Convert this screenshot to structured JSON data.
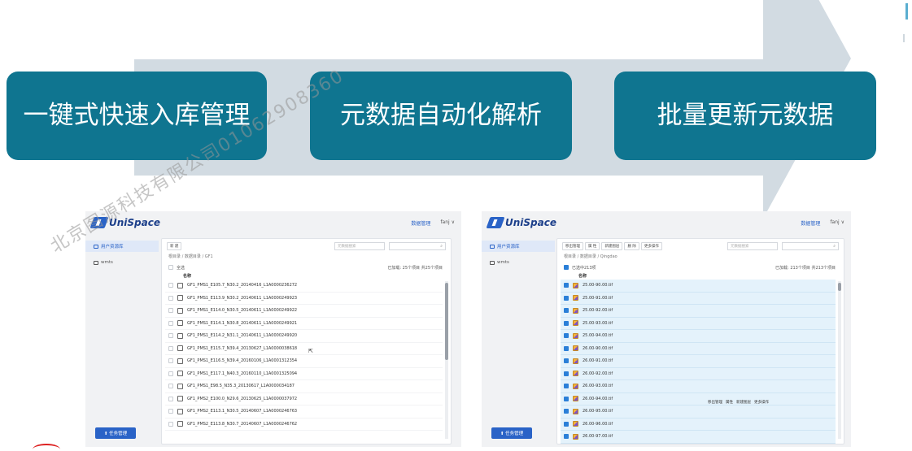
{
  "banner": {
    "steps": [
      "一键式快速入库管理",
      "元数据自动化解析",
      "批量更新元数据"
    ],
    "watermark": "北京图源科技有限公司01062908360"
  },
  "app1": {
    "logo": "UniSpace",
    "nav": {
      "data_mgmt": "数据管理",
      "user": "fanj ∨"
    },
    "sidebar": [
      "用户资源库",
      "wmts"
    ],
    "task_button": "⬆ 任务管理",
    "toolbar": [
      "新 建"
    ],
    "search_select_placeholder": "元数据搜索",
    "breadcrumb": "根目录 / 数据目录 / GF1",
    "select_all": "全选",
    "count": "已加载: 25个项目  共25个项目",
    "column_name": "名称",
    "files": [
      "GF1_PMS1_E105.7_N30.2_20140416_L1A0000236272",
      "GF1_PMS1_E113.9_N30.2_20140611_L1A0000249923",
      "GF1_PMS1_E114.0_N30.5_20140611_L1A0000249922",
      "GF1_PMS1_E114.1_N30.8_20140611_L1A0000249921",
      "GF1_PMS1_E114.2_N31.1_20140611_L1A0000249920",
      "GF1_PMS1_E115.7_N39.4_20130627_L1A0000038618",
      "GF1_PMS1_E116.5_N39.4_20160106_L1A0001312354",
      "GF1_PMS1_E117.1_N40.3_20160110_L1A0001325094",
      "GF1_PMS1_E98.5_N35.3_20130617_L1A0000034187",
      "GF1_PMS2_E100.0_N29.6_20130625_L1A0000037972",
      "GF1_PMS2_E113.1_N30.5_20140607_L1A0000246763",
      "GF1_PMS2_E113.8_N30.7_20140607_L1A0000246762"
    ]
  },
  "app2": {
    "logo": "UniSpace",
    "nav": {
      "data_mgmt": "数据管理",
      "user": "fanj ∨"
    },
    "sidebar": [
      "用户资源库",
      "wmts"
    ],
    "task_button": "⬆ 任务管理",
    "toolbar": [
      "移出管理",
      "属 性",
      "新建图层",
      "删 除",
      "更多操作"
    ],
    "search_select_placeholder": "元数据搜索",
    "breadcrumb": "根目录 / 数据目录 / Qingdao",
    "select_all": "已选中213项",
    "count": "已加载: 213个项目  共213个项目",
    "column_name": "名称",
    "float_actions": [
      "移出管理",
      "属性",
      "新建图层",
      "更多操作"
    ],
    "files": [
      "25.00-90.00.tif",
      "25.00-91.00.tif",
      "25.00-92.00.tif",
      "25.00-93.00.tif",
      "25.00-94.00.tif",
      "26.00-90.00.tif",
      "26.00-91.00.tif",
      "26.00-92.00.tif",
      "26.00-93.00.tif",
      "26.00-94.00.tif",
      "26.00-95.00.tif",
      "26.00-96.00.tif",
      "26.00-97.00.tif"
    ]
  }
}
